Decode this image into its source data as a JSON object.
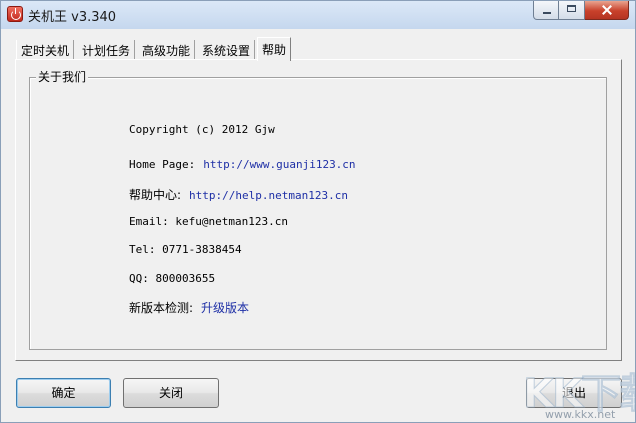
{
  "window": {
    "title": "关机王 v3.340"
  },
  "tabs": [
    {
      "label": "定时关机"
    },
    {
      "label": "计划任务"
    },
    {
      "label": "高级功能"
    },
    {
      "label": "系统设置"
    },
    {
      "label": "帮助",
      "active": true
    }
  ],
  "about": {
    "caption": "关于我们",
    "copyright": "Copyright (c) 2012 Gjw",
    "homepage_label": "Home Page:",
    "homepage_url": "http://www.guanji123.cn",
    "help_label": "帮助中心:",
    "help_url": "http://help.netman123.cn",
    "email": "Email: kefu@netman123.cn",
    "tel": "Tel: 0771-3838454",
    "qq": "QQ: 800003655",
    "update_label": "新版本检测:",
    "update_link": "升级版本"
  },
  "buttons": {
    "ok": "确定",
    "close": "关闭",
    "exit": "退出"
  },
  "watermark": {
    "logo": "KK下载",
    "url": "www.kkx.net"
  },
  "colors": {
    "link": "#1e2fa6",
    "window_bg": "#f0f0f0",
    "close_button": "#c8412b"
  }
}
